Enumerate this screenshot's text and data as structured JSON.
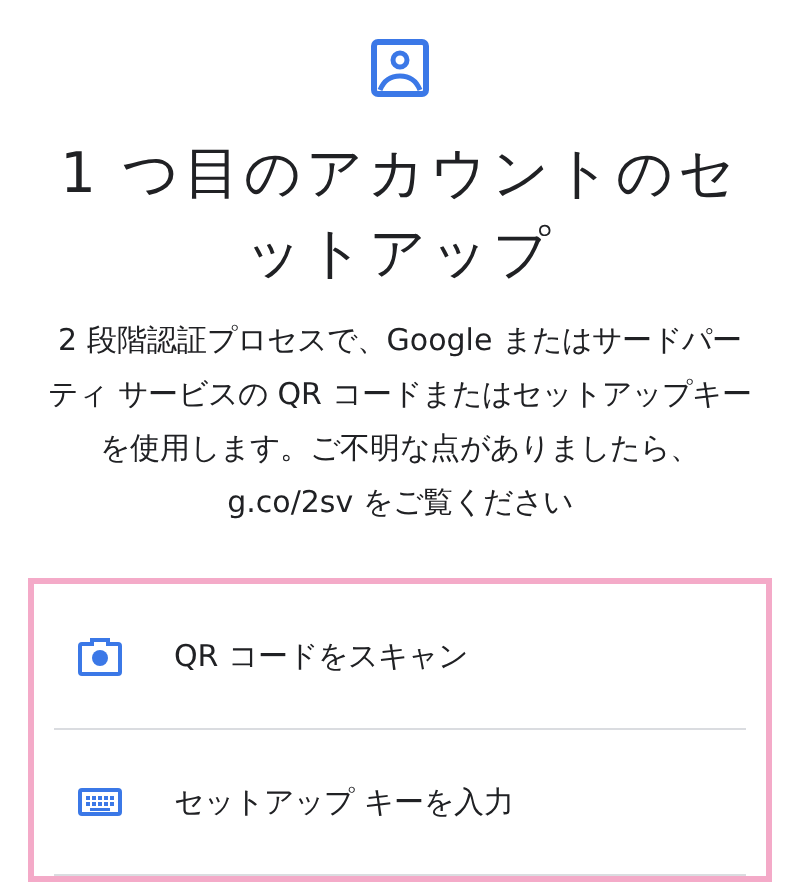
{
  "title": "1 つ目のアカウントのセットアップ",
  "description": "2 段階認証プロセスで、Google またはサードパーティ サービスの QR コードまたはセットアップキーを使用します。ご不明な点がありましたら、g.co/2sv をご覧ください",
  "options": [
    {
      "kind": "camera",
      "label": "QR コードをスキャン"
    },
    {
      "kind": "keyboard",
      "label": "セットアップ キーを入力"
    }
  ]
}
